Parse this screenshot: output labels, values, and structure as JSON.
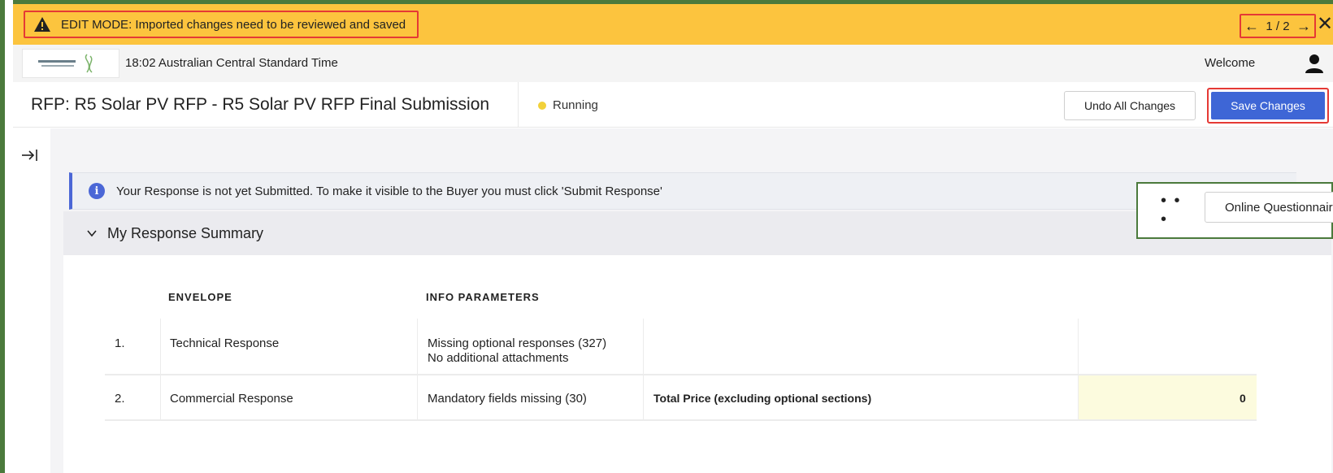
{
  "banner": {
    "message": "EDIT MODE: Imported changes need to be reviewed and saved",
    "pager": "1 / 2",
    "colors": {
      "banner_bg": "#fcc43e",
      "highlight": "#e53935"
    }
  },
  "topbar": {
    "time": "18:02 Australian Central Standard Time",
    "welcome": "Welcome"
  },
  "titlebar": {
    "title": "RFP: R5 Solar PV RFP - R5 Solar PV RFP Final Submission",
    "status": "Running",
    "undo_label": "Undo All Changes",
    "save_label": "Save Changes"
  },
  "alert": {
    "text": "Your Response is not yet Submitted. To make it visible to the Buyer you must click 'Submit Response'"
  },
  "actions": {
    "more_label": "• • •",
    "online_label": "Online Questionnaire"
  },
  "summary": {
    "title": "My Response Summary",
    "headers": {
      "envelope": "ENVELOPE",
      "info": "INFO PARAMETERS"
    },
    "rows": [
      {
        "num": "1.",
        "envelope": "Technical Response",
        "info_line1": "Missing optional responses (327)",
        "info_line2": "No additional attachments",
        "extra_label": "",
        "extra_value": ""
      },
      {
        "num": "2.",
        "envelope": "Commercial Response",
        "info_line1": "Mandatory fields missing (30)",
        "info_line2": "",
        "extra_label": "Total Price (excluding optional sections)",
        "extra_value": "0"
      }
    ]
  },
  "icons": {
    "warning": "warning-icon",
    "prev": "arrow-left-icon",
    "next": "arrow-right-icon",
    "close": "close-icon",
    "user": "user-icon",
    "expand": "expand-sidebar-icon",
    "info": "info-icon",
    "chevron": "chevron-down-icon"
  }
}
